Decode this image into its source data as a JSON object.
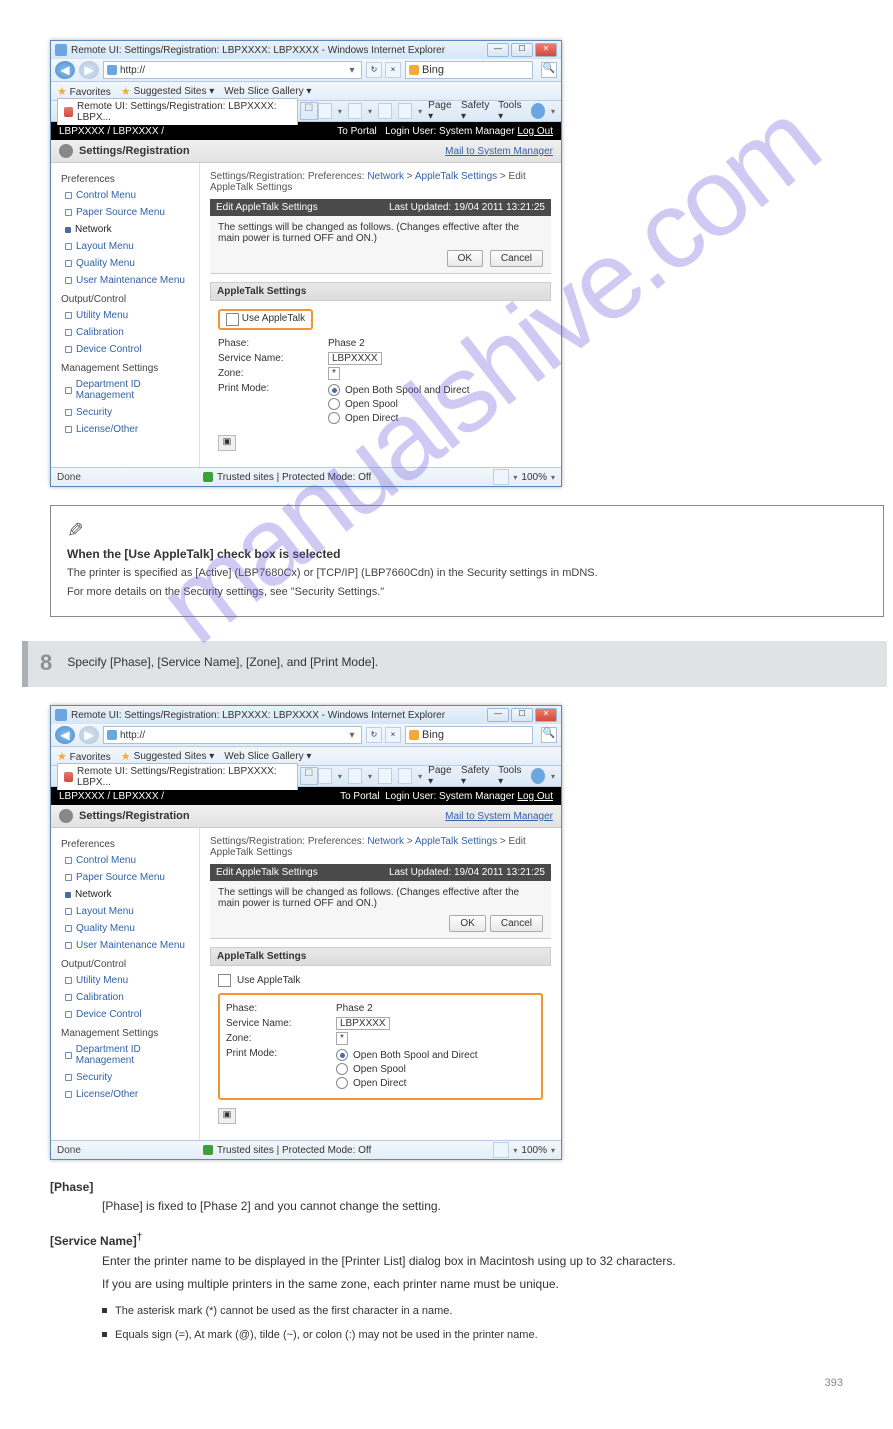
{
  "watermark": "manualshive.com",
  "window": {
    "title": "Remote UI: Settings/Registration: LBPXXXX: LBPXXXX - Windows Internet Explorer",
    "url": "http://",
    "searchProvider": "Bing",
    "favorites": "Favorites",
    "suggested": "Suggested Sites ▾",
    "webSlice": "Web Slice Gallery ▾",
    "tabTitle": "Remote UI: Settings/Registration: LBPXXXX: LBPX...",
    "tools": {
      "page": "Page ▾",
      "safety": "Safety ▾",
      "tools": "Tools ▾"
    },
    "statusDone": "Done",
    "statusTrust": "Trusted sites | Protected Mode: Off",
    "zoom": "100%"
  },
  "app": {
    "device": "LBPXXXX / LBPXXXX /",
    "portal": "To Portal",
    "loginLabel": "Login User:",
    "loginUser": "System Manager",
    "logout": "Log Out",
    "srTitle": "Settings/Registration",
    "mailLink": "Mail to System Manager",
    "breadcrumb": {
      "a": "Settings/Registration: Preferences:",
      "b": "Network",
      "c": "AppleTalk Settings",
      "d": "Edit AppleTalk Settings"
    },
    "bandTitle": "Edit AppleTalk Settings",
    "bandUpdated": "Last Updated: 19/04 2011 13:21:25",
    "changeMsg": "The settings will be changed as follows. (Changes effective after the main power is turned OFF and ON.)",
    "okBtn": "OK",
    "cancelBtn": "Cancel",
    "sectTitle": "AppleTalk Settings",
    "useAppleTalk": "Use AppleTalk",
    "phaseLabel": "Phase:",
    "phaseVal": "Phase 2",
    "serviceLabel": "Service Name:",
    "serviceVal": "LBPXXXX",
    "zoneLabel": "Zone:",
    "zoneVal": "*",
    "printModeLabel": "Print Mode:",
    "pm1": "Open Both Spool and Direct",
    "pm2": "Open Spool",
    "pm3": "Open Direct"
  },
  "sidebar": {
    "groups": [
      {
        "title": "Preferences",
        "items": [
          "Control Menu",
          "Paper Source Menu",
          "Network",
          "Layout Menu",
          "Quality Menu",
          "User Maintenance Menu"
        ],
        "active": 2
      },
      {
        "title": "Output/Control",
        "items": [
          "Utility Menu",
          "Calibration",
          "Device Control"
        ]
      },
      {
        "title": "Management Settings",
        "items": [
          "Department ID Management",
          "Security",
          "License/Other"
        ]
      }
    ]
  },
  "note": {
    "title": "When the [Use AppleTalk] check box is selected",
    "p1": "The printer is specified as [Active] (LBP7680Cx) or [TCP/IP] (LBP7660Cdn) in the Security settings in mDNS.",
    "p2": "For more details on the Security settings, see \"Security Settings.\""
  },
  "step": {
    "num": "8",
    "text": "Specify [Phase], [Service Name], [Zone], and [Print Mode]."
  },
  "body": {
    "phaseHead": "[Phase]",
    "phaseBody": "[Phase] is fixed to [Phase 2] and you cannot change the setting.",
    "snHead": "[Service Name]",
    "snBody": "Enter the printer name to be displayed in the [Printer List] dialog box in Macintosh using up to 32 characters.",
    "snNote": "If you are using multiple printers in the same zone, each printer name must be unique.",
    "snNoteBullets": [
      "The asterisk mark (*) cannot be used as the first character in a name.",
      "Equals sign (=), At mark (@), tilde (~), or colon (:) may not be used in the printer name."
    ],
    "dagger": "†"
  },
  "pageNumber": "393"
}
